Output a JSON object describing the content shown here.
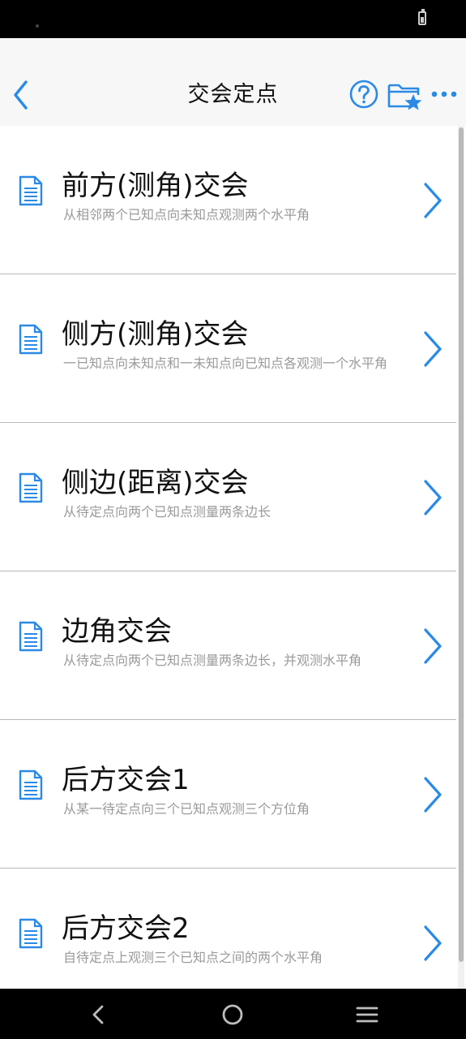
{
  "header": {
    "title": "交会定点"
  },
  "icons": {
    "back": "chevron-left-icon",
    "help": "question-circle-icon",
    "folder": "folder-star-icon",
    "more": "more-dots-icon",
    "row_icon": "document-icon",
    "row_arrow": "chevron-right-icon"
  },
  "colors": {
    "accent": "#2a8ae6",
    "header_bg": "#f7f7f7",
    "subtitle": "#9a9a9a"
  },
  "items": [
    {
      "title": "前方(测角)交会",
      "subtitle": "从相邻两个已知点向未知点观测两个水平角"
    },
    {
      "title": "侧方(测角)交会",
      "subtitle": "一已知点向未知点和一未知点向已知点各观测一个水平角"
    },
    {
      "title": "侧边(距离)交会",
      "subtitle": "从待定点向两个已知点测量两条边长"
    },
    {
      "title": "边角交会",
      "subtitle": "从待定点向两个已知点测量两条边长，并观测水平角"
    },
    {
      "title": "后方交会1",
      "subtitle": "从某一待定点向三个已知点观测三个方位角"
    },
    {
      "title": "后方交会2",
      "subtitle": "自待定点上观测三个已知点之间的两个水平角"
    }
  ]
}
